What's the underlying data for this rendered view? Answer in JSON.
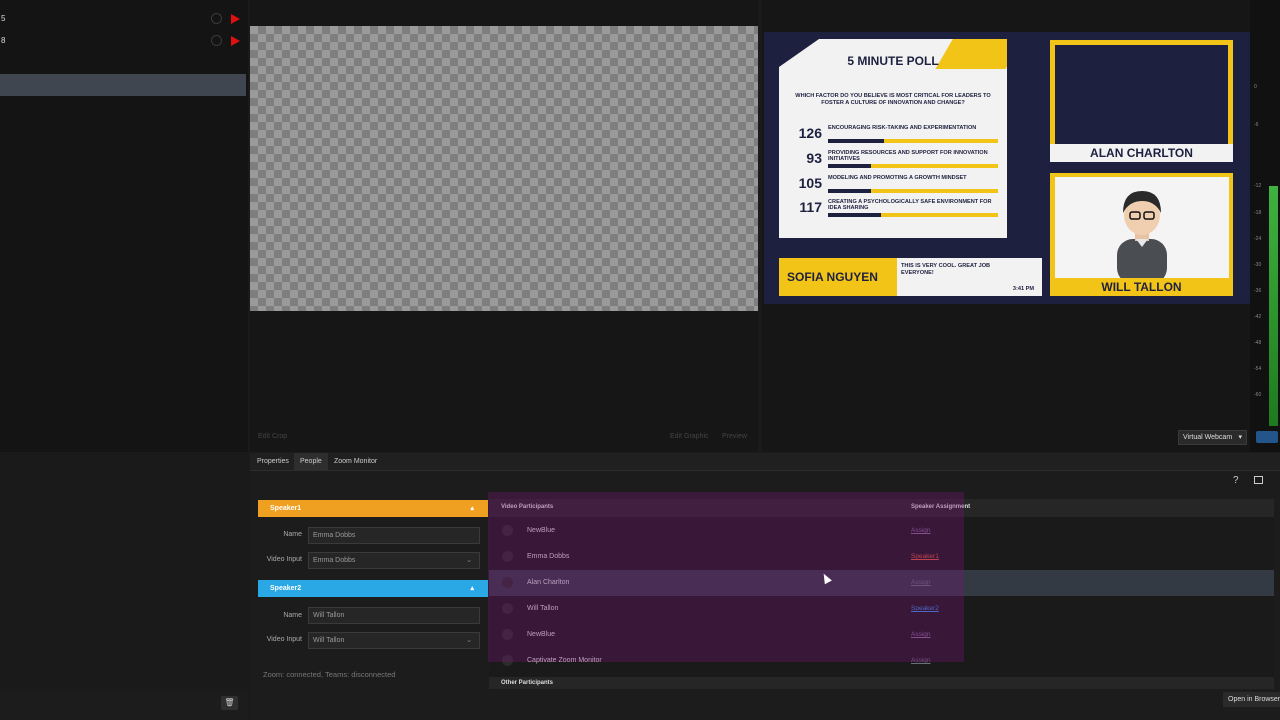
{
  "scene_list": {
    "rows": [
      {
        "num": "5"
      },
      {
        "num": "8"
      }
    ]
  },
  "program": {
    "left_faint": "Edit Crop",
    "right_faint1": "Edit Graphic",
    "right_faint2": "Preview"
  },
  "output": {
    "poll": {
      "title": "5 MINUTE POLL",
      "question": "WHICH FACTOR DO YOU BELIEVE IS MOST CRITICAL FOR LEADERS TO FOSTER A CULTURE OF INNOVATION AND CHANGE?",
      "options": [
        {
          "count": "126",
          "text": "ENCOURAGING RISK-TAKING AND EXPERIMENTATION",
          "fraction": 0.33
        },
        {
          "count": "93",
          "text": "PROVIDING RESOURCES AND SUPPORT FOR INNOVATION INITIATIVES",
          "fraction": 0.25
        },
        {
          "count": "105",
          "text": "MODELING AND PROMOTING A GROWTH MINDSET",
          "fraction": 0.25
        },
        {
          "count": "117",
          "text": "CREATING A PSYCHOLOGICALLY SAFE ENVIRONMENT FOR IDEA SHARING",
          "fraction": 0.31
        }
      ]
    },
    "cam1_name": "ALAN CHARLTON",
    "cam2_name": "WILL TALLON",
    "lower_third": {
      "name": "SOFIA NGUYEN",
      "message": "THIS IS VERY COOL. GREAT JOB EVERYONE!",
      "time": "3:41 PM"
    },
    "colors": {
      "accent": "#f2c418",
      "navy": "#1e2040"
    }
  },
  "meter": {
    "ticks": [
      "0",
      "-6",
      "-12",
      "-18",
      "-24",
      "-30",
      "-36",
      "-42",
      "-48",
      "-54",
      "-60"
    ]
  },
  "output_select": {
    "value": "Virtual Webcam"
  },
  "tabs": [
    {
      "label": "Properties",
      "active": false
    },
    {
      "label": "People",
      "active": true
    },
    {
      "label": "Zoom Monitor",
      "active": false
    }
  ],
  "speakers": [
    {
      "header": "Speaker1",
      "name_label": "Name",
      "name_value": "Emma Dobbs",
      "video_label": "Video Input",
      "video_value": "Emma Dobbs",
      "color": "#f0a020"
    },
    {
      "header": "Speaker2",
      "name_label": "Name",
      "name_value": "Will Tallon",
      "video_label": "Video Input",
      "video_value": "Will Tallon",
      "color": "#2aa8e6"
    }
  ],
  "zoom_status": "Zoom: connected, Teams: disconnected",
  "participants": {
    "col1": "Video Participants",
    "col2": "Speaker Assignment",
    "rows": [
      {
        "name": "NewBlue",
        "assign": "Assign",
        "assign_color": "#8a6a9a"
      },
      {
        "name": "Emma Dobbs",
        "assign": "Speaker1",
        "assign_color": "#e05a3a"
      },
      {
        "name": "Alan Charlton",
        "assign": "Assign",
        "assign_color": "#6f6f7f",
        "highlight": true
      },
      {
        "name": "Will Tallon",
        "assign": "Speaker2",
        "assign_color": "#3a8ee6"
      },
      {
        "name": "NewBlue",
        "assign": "Assign",
        "assign_color": "#8a6a9a"
      },
      {
        "name": "Captivate Zoom Monitor",
        "assign": "Assign",
        "assign_color": "#6f6f7f"
      }
    ],
    "other_header": "Other Participants"
  },
  "open_browser": "Open in Browser"
}
